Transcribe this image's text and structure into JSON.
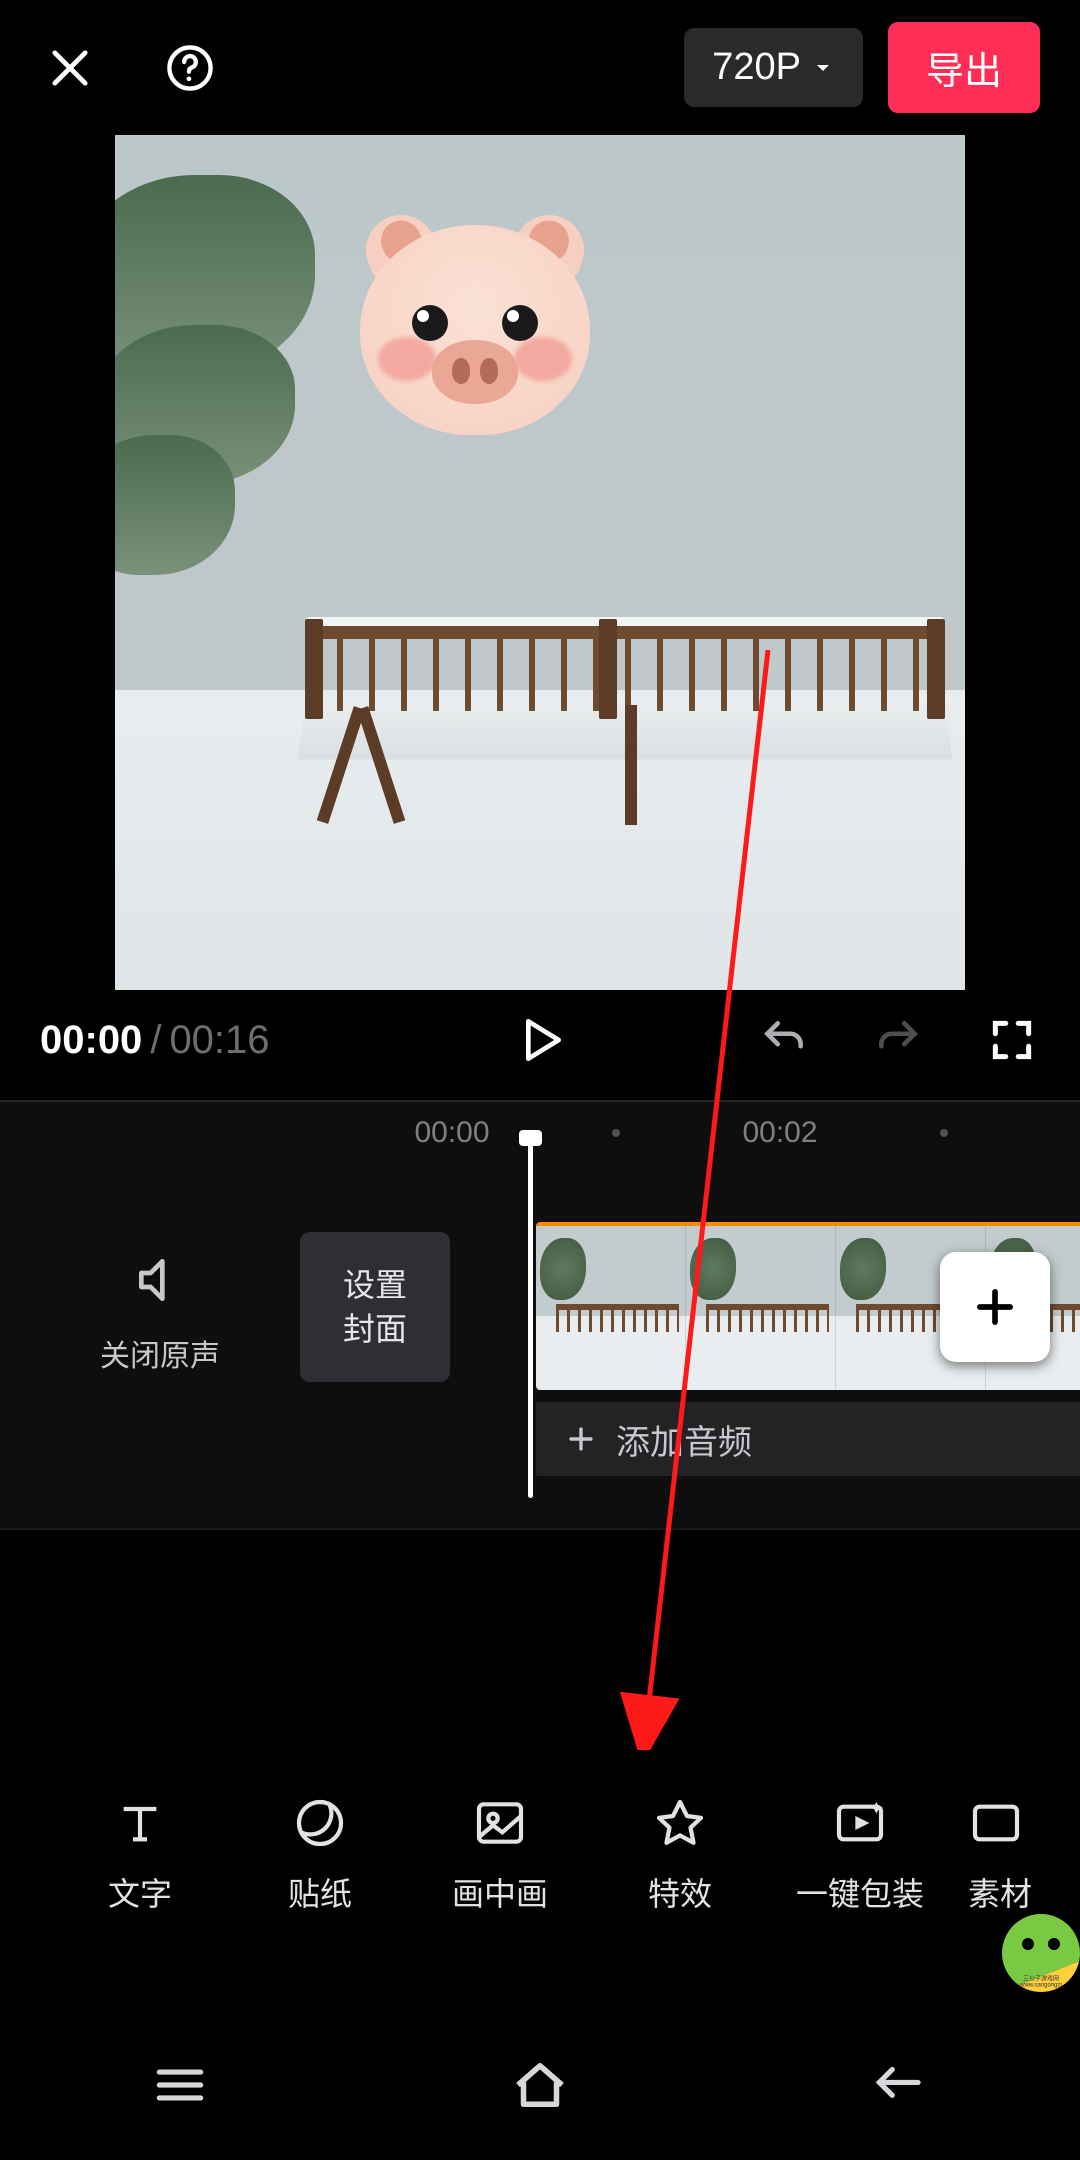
{
  "header": {
    "resolution_label": "720P",
    "export_label": "导出"
  },
  "transport": {
    "current_time": "00:00",
    "separator": "/",
    "duration": "00:16"
  },
  "ruler": {
    "ticks": [
      "00:00",
      "00:02"
    ]
  },
  "timeline": {
    "mute_label": "关闭原声",
    "cover_line1": "设置",
    "cover_line2": "封面",
    "add_audio_label": "添加音频"
  },
  "tools": [
    {
      "key": "text",
      "label": "文字"
    },
    {
      "key": "sticker",
      "label": "贴纸"
    },
    {
      "key": "pip",
      "label": "画中画"
    },
    {
      "key": "effect",
      "label": "特效"
    },
    {
      "key": "package",
      "label": "一键包装"
    },
    {
      "key": "material",
      "label": "素材"
    }
  ],
  "watermark": {
    "line1": "三公子游戏网",
    "line2": "www.sangongzi"
  }
}
